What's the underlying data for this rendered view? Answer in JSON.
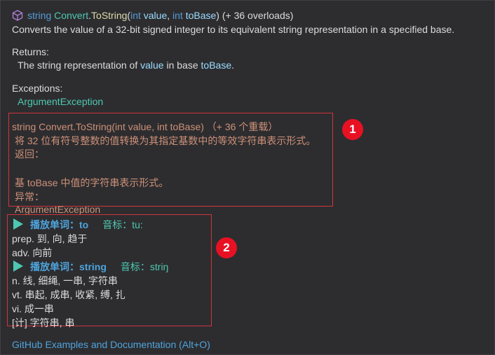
{
  "signature": {
    "icon": "cube-icon",
    "return_type": "string",
    "class_name": "Convert",
    "dot": ".",
    "method": "ToString",
    "open_paren": "(",
    "p1_type": "int",
    "p1_name": "value",
    "comma": ",",
    "p2_type": "int",
    "p2_name": "toBase",
    "close_paren": ")",
    "overloads": "(+ 36 overloads)"
  },
  "summary": "Converts the value of a 32-bit signed integer to its equivalent string representation in a specified base.",
  "returns": {
    "heading": "Returns:",
    "pre": "The string representation of",
    "param1": "value",
    "mid": "in base",
    "param2": "toBase",
    "post": "."
  },
  "exceptions": {
    "heading": "Exceptions:",
    "item": "ArgumentException"
  },
  "translation": {
    "badge": "1",
    "lines": [
      "string Convert.ToString(int value, int toBase) （+ 36 个重载）",
      "将 32 位有符号整数的值转换为其指定基数中的等效字符串表示形式。",
      "返回：",
      "",
      "基 toBase 中值的字符串表示形式。",
      "异常：",
      "ArgumentException"
    ]
  },
  "dictionary": {
    "badge": "2",
    "entries": [
      {
        "play_label": "播放单词：to",
        "phonetic": "音标：tu:",
        "defs": [
          "prep. 到, 向, 趋于",
          "adv. 向前"
        ]
      },
      {
        "play_label": "播放单词：string",
        "phonetic": "音标：striŋ",
        "defs": [
          "n. 线, 细绳, 一串, 字符串",
          "vt. 串起, 成串, 收紧, 缚, 扎",
          "vi. 成一串",
          "[计] 字符串, 串"
        ]
      }
    ]
  },
  "footer": {
    "link": "GitHub Examples and Documentation (Alt+O)"
  },
  "colors": {
    "background": "#2d2d30",
    "text": "#dcdcdc",
    "keyword": "#569cd6",
    "type": "#4ec9b0",
    "method": "#dcdcaa",
    "param": "#9cdcfe",
    "translation": "#ce9178",
    "annotation_red": "#d13438"
  }
}
